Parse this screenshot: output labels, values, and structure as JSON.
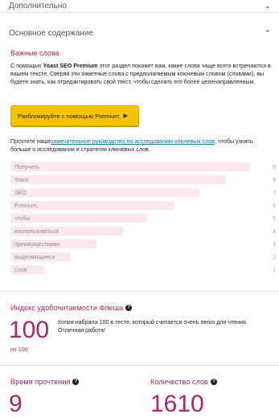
{
  "panels": {
    "advanced": {
      "title": "Дополнительно"
    },
    "basic": {
      "title": "Основное содержание"
    }
  },
  "key_words": {
    "heading": "Важные слова",
    "intro_prefix": "С помощью ",
    "intro_bold": "Yoast SEO Premium",
    "intro_suffix": " этот раздел покажет вам, какие слова чаще всего встречаются в вашем тексте. Сверяя эти заметные слова с предполагаемым ключевым словом (словами), вы будете знать, как отредактировать свой текст, чтобы сделать его более целенаправленным.",
    "unlock_button": "Разблокируйте с помощью Premium",
    "read_prefix": "Прочтите наше",
    "read_link": "замечательное руководство по исследованию ключевых слов",
    "read_suffix": ", чтобы узнать больше о исследовании и стратегии ключевых слов.",
    "words": [
      {
        "label": "Получить",
        "count": "9",
        "fraction": 1.0
      },
      {
        "label": "Yoast",
        "count": "8",
        "fraction": 0.9
      },
      {
        "label": "SEO",
        "count": "7",
        "fraction": 0.79
      },
      {
        "label": "Premium,",
        "count": "6",
        "fraction": 0.68
      },
      {
        "label": "чтобы",
        "count": "5",
        "fraction": 0.57
      },
      {
        "label": "воспользоваться",
        "count": "4",
        "fraction": 0.47
      },
      {
        "label": "преимуществами",
        "count": "3",
        "fraction": 0.36
      },
      {
        "label": "выделяющиеся",
        "count": "2",
        "fraction": 0.25
      },
      {
        "label": "слов",
        "count": "1",
        "fraction": 0.14
      }
    ]
  },
  "flesch": {
    "title": "Индекс удобочитаемости Флеша",
    "score": "100",
    "out_of": "из 100",
    "description": "Копия набрала 100 в тесте, который считается очень легко для чтения. Отличная работа!"
  },
  "reading_time": {
    "title": "Время прочтения",
    "value": "9"
  },
  "word_count": {
    "title": "Количество слов",
    "value": "1610"
  },
  "icons": {
    "chevron_down": "chevron-down-icon",
    "chevron_up": "chevron-up-icon",
    "caret_right": "caret-right-icon",
    "question": "question-circle-icon"
  },
  "colors": {
    "accent": "#a4286a",
    "button": "#f7c200",
    "link": "#0073aa",
    "bar": "#fde7ee"
  }
}
